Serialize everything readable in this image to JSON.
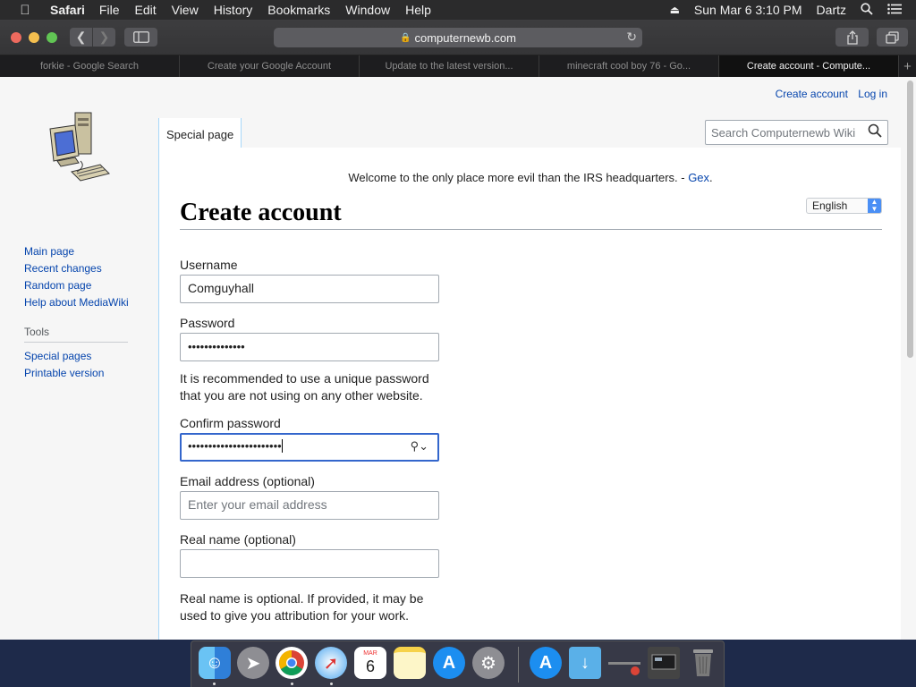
{
  "menubar": {
    "app": "Safari",
    "items": [
      "File",
      "Edit",
      "View",
      "History",
      "Bookmarks",
      "Window",
      "Help"
    ],
    "datetime": "Sun Mar 6  3:10 PM",
    "user": "Dartz"
  },
  "browser": {
    "url": "computernewb.com",
    "tabs": [
      "forkie - Google Search",
      "Create your Google Account",
      "Update to the latest version...",
      "minecraft cool boy 76 - Go...",
      "Create account - Compute..."
    ],
    "active_tab": 4
  },
  "wiki": {
    "personal": {
      "create_account": "Create account",
      "login": "Log in"
    },
    "page_tab": "Special page",
    "search_placeholder": "Search Computernewb Wiki",
    "nav": [
      "Main page",
      "Recent changes",
      "Random page",
      "Help about MediaWiki"
    ],
    "tools_heading": "Tools",
    "tools": [
      "Special pages",
      "Printable version"
    ],
    "sitenotice": "Welcome to the only place more evil than the IRS headquarters. - ",
    "sitenotice_link": "Gex",
    "sitenotice_end": ".",
    "language": "English",
    "title": "Create account",
    "form": {
      "username_label": "Username",
      "username_value": "Comguyhall",
      "password_label": "Password",
      "password_value": "••••••••••••••",
      "password_help": "It is recommended to use a unique password that you are not using on any other website.",
      "confirm_label": "Confirm password",
      "confirm_value": "•••••••••••••••••••••••",
      "email_label": "Email address (optional)",
      "email_placeholder": "Enter your email address",
      "realname_label": "Real name (optional)",
      "realname_help": "Real name is optional. If provided, it may be used to give you attribution for your work."
    }
  },
  "dock": {
    "calendar_month": "MAR",
    "calendar_day": "6"
  }
}
